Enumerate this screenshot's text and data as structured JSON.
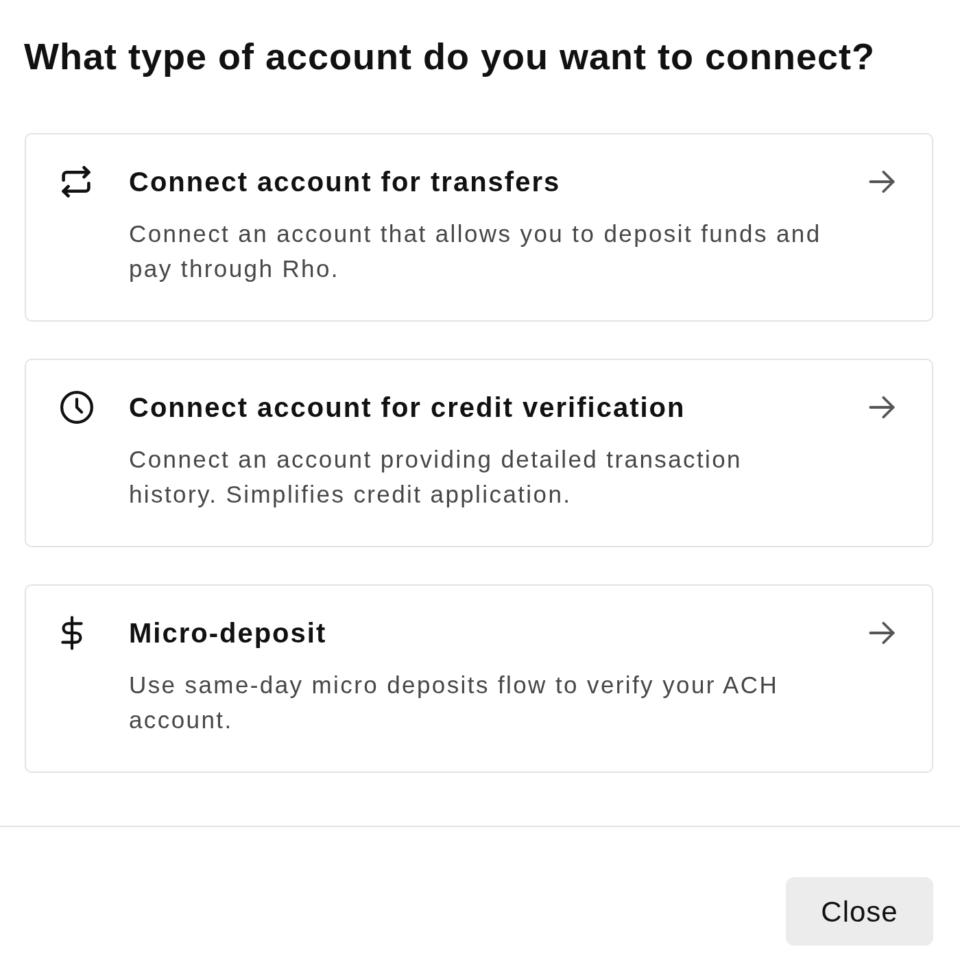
{
  "dialog": {
    "title": "What type of account do you want to connect?",
    "options": [
      {
        "title": "Connect account for transfers",
        "description": "Connect an account that allows you to deposit funds and pay through Rho."
      },
      {
        "title": "Connect account for credit verification",
        "description": "Connect an account providing detailed transaction history. Simplifies credit application."
      },
      {
        "title": "Micro-deposit",
        "description": "Use same-day micro deposits flow to verify your ACH account."
      }
    ],
    "buttons": [
      {
        "label": "Close"
      }
    ]
  }
}
